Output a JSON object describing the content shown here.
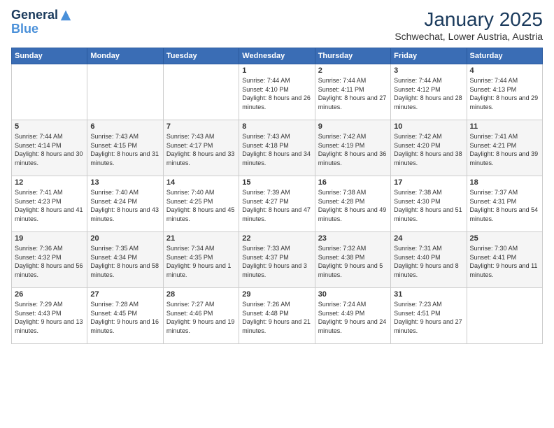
{
  "logo": {
    "line1": "General",
    "line2": "Blue"
  },
  "title": "January 2025",
  "location": "Schwechat, Lower Austria, Austria",
  "weekdays": [
    "Sunday",
    "Monday",
    "Tuesday",
    "Wednesday",
    "Thursday",
    "Friday",
    "Saturday"
  ],
  "weeks": [
    [
      {
        "day": "",
        "sunrise": "",
        "sunset": "",
        "daylight": ""
      },
      {
        "day": "",
        "sunrise": "",
        "sunset": "",
        "daylight": ""
      },
      {
        "day": "",
        "sunrise": "",
        "sunset": "",
        "daylight": ""
      },
      {
        "day": "1",
        "sunrise": "Sunrise: 7:44 AM",
        "sunset": "Sunset: 4:10 PM",
        "daylight": "Daylight: 8 hours and 26 minutes."
      },
      {
        "day": "2",
        "sunrise": "Sunrise: 7:44 AM",
        "sunset": "Sunset: 4:11 PM",
        "daylight": "Daylight: 8 hours and 27 minutes."
      },
      {
        "day": "3",
        "sunrise": "Sunrise: 7:44 AM",
        "sunset": "Sunset: 4:12 PM",
        "daylight": "Daylight: 8 hours and 28 minutes."
      },
      {
        "day": "4",
        "sunrise": "Sunrise: 7:44 AM",
        "sunset": "Sunset: 4:13 PM",
        "daylight": "Daylight: 8 hours and 29 minutes."
      }
    ],
    [
      {
        "day": "5",
        "sunrise": "Sunrise: 7:44 AM",
        "sunset": "Sunset: 4:14 PM",
        "daylight": "Daylight: 8 hours and 30 minutes."
      },
      {
        "day": "6",
        "sunrise": "Sunrise: 7:43 AM",
        "sunset": "Sunset: 4:15 PM",
        "daylight": "Daylight: 8 hours and 31 minutes."
      },
      {
        "day": "7",
        "sunrise": "Sunrise: 7:43 AM",
        "sunset": "Sunset: 4:17 PM",
        "daylight": "Daylight: 8 hours and 33 minutes."
      },
      {
        "day": "8",
        "sunrise": "Sunrise: 7:43 AM",
        "sunset": "Sunset: 4:18 PM",
        "daylight": "Daylight: 8 hours and 34 minutes."
      },
      {
        "day": "9",
        "sunrise": "Sunrise: 7:42 AM",
        "sunset": "Sunset: 4:19 PM",
        "daylight": "Daylight: 8 hours and 36 minutes."
      },
      {
        "day": "10",
        "sunrise": "Sunrise: 7:42 AM",
        "sunset": "Sunset: 4:20 PM",
        "daylight": "Daylight: 8 hours and 38 minutes."
      },
      {
        "day": "11",
        "sunrise": "Sunrise: 7:41 AM",
        "sunset": "Sunset: 4:21 PM",
        "daylight": "Daylight: 8 hours and 39 minutes."
      }
    ],
    [
      {
        "day": "12",
        "sunrise": "Sunrise: 7:41 AM",
        "sunset": "Sunset: 4:23 PM",
        "daylight": "Daylight: 8 hours and 41 minutes."
      },
      {
        "day": "13",
        "sunrise": "Sunrise: 7:40 AM",
        "sunset": "Sunset: 4:24 PM",
        "daylight": "Daylight: 8 hours and 43 minutes."
      },
      {
        "day": "14",
        "sunrise": "Sunrise: 7:40 AM",
        "sunset": "Sunset: 4:25 PM",
        "daylight": "Daylight: 8 hours and 45 minutes."
      },
      {
        "day": "15",
        "sunrise": "Sunrise: 7:39 AM",
        "sunset": "Sunset: 4:27 PM",
        "daylight": "Daylight: 8 hours and 47 minutes."
      },
      {
        "day": "16",
        "sunrise": "Sunrise: 7:38 AM",
        "sunset": "Sunset: 4:28 PM",
        "daylight": "Daylight: 8 hours and 49 minutes."
      },
      {
        "day": "17",
        "sunrise": "Sunrise: 7:38 AM",
        "sunset": "Sunset: 4:30 PM",
        "daylight": "Daylight: 8 hours and 51 minutes."
      },
      {
        "day": "18",
        "sunrise": "Sunrise: 7:37 AM",
        "sunset": "Sunset: 4:31 PM",
        "daylight": "Daylight: 8 hours and 54 minutes."
      }
    ],
    [
      {
        "day": "19",
        "sunrise": "Sunrise: 7:36 AM",
        "sunset": "Sunset: 4:32 PM",
        "daylight": "Daylight: 8 hours and 56 minutes."
      },
      {
        "day": "20",
        "sunrise": "Sunrise: 7:35 AM",
        "sunset": "Sunset: 4:34 PM",
        "daylight": "Daylight: 8 hours and 58 minutes."
      },
      {
        "day": "21",
        "sunrise": "Sunrise: 7:34 AM",
        "sunset": "Sunset: 4:35 PM",
        "daylight": "Daylight: 9 hours and 1 minute."
      },
      {
        "day": "22",
        "sunrise": "Sunrise: 7:33 AM",
        "sunset": "Sunset: 4:37 PM",
        "daylight": "Daylight: 9 hours and 3 minutes."
      },
      {
        "day": "23",
        "sunrise": "Sunrise: 7:32 AM",
        "sunset": "Sunset: 4:38 PM",
        "daylight": "Daylight: 9 hours and 5 minutes."
      },
      {
        "day": "24",
        "sunrise": "Sunrise: 7:31 AM",
        "sunset": "Sunset: 4:40 PM",
        "daylight": "Daylight: 9 hours and 8 minutes."
      },
      {
        "day": "25",
        "sunrise": "Sunrise: 7:30 AM",
        "sunset": "Sunset: 4:41 PM",
        "daylight": "Daylight: 9 hours and 11 minutes."
      }
    ],
    [
      {
        "day": "26",
        "sunrise": "Sunrise: 7:29 AM",
        "sunset": "Sunset: 4:43 PM",
        "daylight": "Daylight: 9 hours and 13 minutes."
      },
      {
        "day": "27",
        "sunrise": "Sunrise: 7:28 AM",
        "sunset": "Sunset: 4:45 PM",
        "daylight": "Daylight: 9 hours and 16 minutes."
      },
      {
        "day": "28",
        "sunrise": "Sunrise: 7:27 AM",
        "sunset": "Sunset: 4:46 PM",
        "daylight": "Daylight: 9 hours and 19 minutes."
      },
      {
        "day": "29",
        "sunrise": "Sunrise: 7:26 AM",
        "sunset": "Sunset: 4:48 PM",
        "daylight": "Daylight: 9 hours and 21 minutes."
      },
      {
        "day": "30",
        "sunrise": "Sunrise: 7:24 AM",
        "sunset": "Sunset: 4:49 PM",
        "daylight": "Daylight: 9 hours and 24 minutes."
      },
      {
        "day": "31",
        "sunrise": "Sunrise: 7:23 AM",
        "sunset": "Sunset: 4:51 PM",
        "daylight": "Daylight: 9 hours and 27 minutes."
      },
      {
        "day": "",
        "sunrise": "",
        "sunset": "",
        "daylight": ""
      }
    ]
  ]
}
